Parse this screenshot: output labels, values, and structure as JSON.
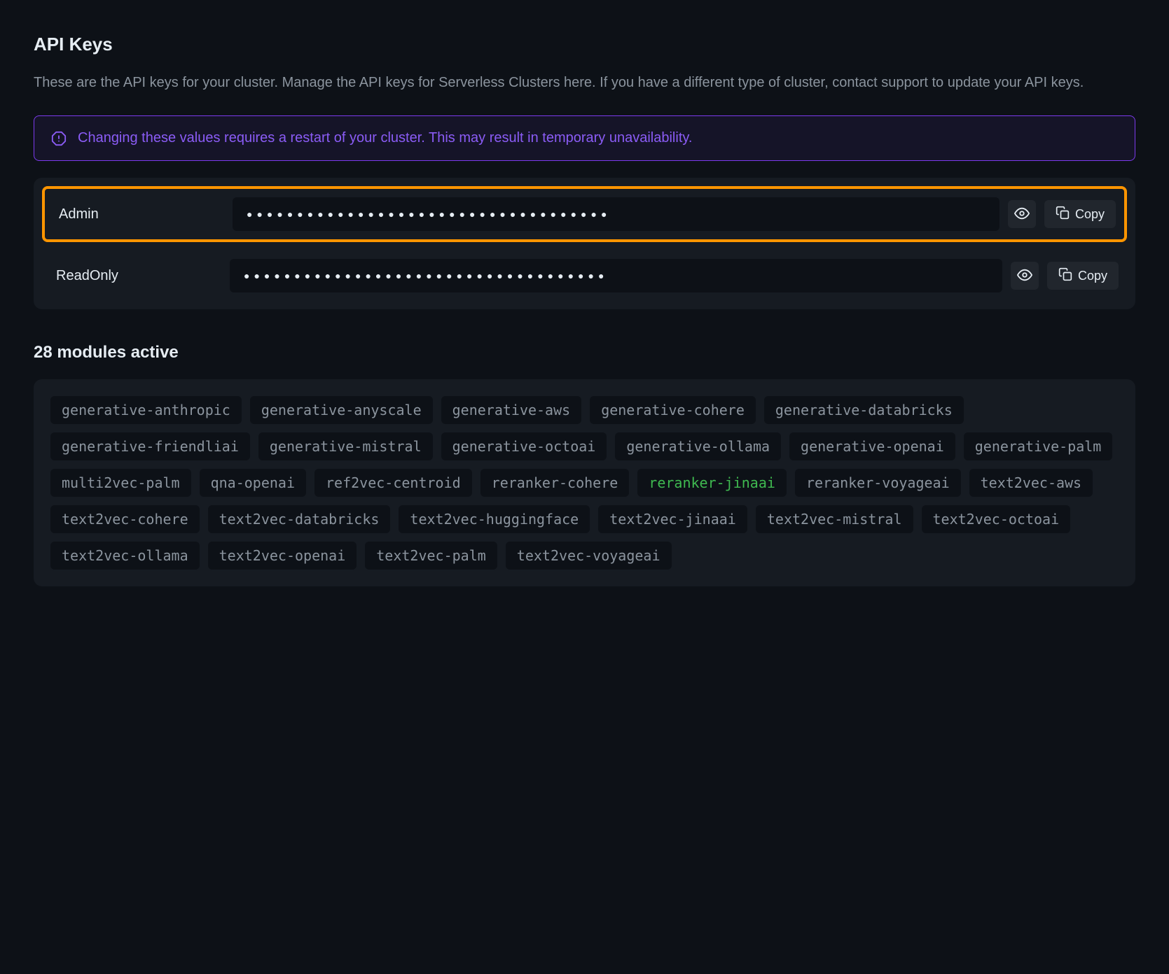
{
  "api_keys_section": {
    "heading": "API Keys",
    "description": "These are the API keys for your cluster. Manage the API keys for Serverless Clusters here. If you have a different type of cluster, contact support to update your API keys.",
    "alert_text": "Changing these values requires a restart of your cluster. This may result in temporary unavailability."
  },
  "api_keys": [
    {
      "label": "Admin",
      "masked_value": "●●●●●●●●●●●●●●●●●●●●●●●●●●●●●●●●●●●●",
      "highlighted": true,
      "copy_label": "Copy"
    },
    {
      "label": "ReadOnly",
      "masked_value": "●●●●●●●●●●●●●●●●●●●●●●●●●●●●●●●●●●●●",
      "highlighted": false,
      "copy_label": "Copy"
    }
  ],
  "modules_section": {
    "heading": "28 modules active"
  },
  "modules": [
    {
      "name": "generative-anthropic",
      "highlighted": false
    },
    {
      "name": "generative-anyscale",
      "highlighted": false
    },
    {
      "name": "generative-aws",
      "highlighted": false
    },
    {
      "name": "generative-cohere",
      "highlighted": false
    },
    {
      "name": "generative-databricks",
      "highlighted": false
    },
    {
      "name": "generative-friendliai",
      "highlighted": false
    },
    {
      "name": "generative-mistral",
      "highlighted": false
    },
    {
      "name": "generative-octoai",
      "highlighted": false
    },
    {
      "name": "generative-ollama",
      "highlighted": false
    },
    {
      "name": "generative-openai",
      "highlighted": false
    },
    {
      "name": "generative-palm",
      "highlighted": false
    },
    {
      "name": "multi2vec-palm",
      "highlighted": false
    },
    {
      "name": "qna-openai",
      "highlighted": false
    },
    {
      "name": "ref2vec-centroid",
      "highlighted": false
    },
    {
      "name": "reranker-cohere",
      "highlighted": false
    },
    {
      "name": "reranker-jinaai",
      "highlighted": true
    },
    {
      "name": "reranker-voyageai",
      "highlighted": false
    },
    {
      "name": "text2vec-aws",
      "highlighted": false
    },
    {
      "name": "text2vec-cohere",
      "highlighted": false
    },
    {
      "name": "text2vec-databricks",
      "highlighted": false
    },
    {
      "name": "text2vec-huggingface",
      "highlighted": false
    },
    {
      "name": "text2vec-jinaai",
      "highlighted": false
    },
    {
      "name": "text2vec-mistral",
      "highlighted": false
    },
    {
      "name": "text2vec-octoai",
      "highlighted": false
    },
    {
      "name": "text2vec-ollama",
      "highlighted": false
    },
    {
      "name": "text2vec-openai",
      "highlighted": false
    },
    {
      "name": "text2vec-palm",
      "highlighted": false
    },
    {
      "name": "text2vec-voyageai",
      "highlighted": false
    }
  ]
}
